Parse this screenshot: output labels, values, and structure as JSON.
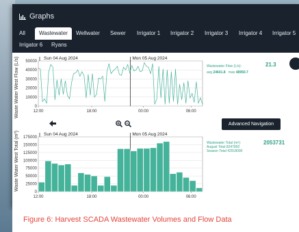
{
  "header": {
    "title": "Graphs",
    "title_icon": "bar-chart-icon"
  },
  "tabs": [
    {
      "label": "All",
      "active": false
    },
    {
      "label": "Wastewater",
      "active": true
    },
    {
      "label": "Wellwater",
      "active": false
    },
    {
      "label": "Sewer",
      "active": false
    },
    {
      "label": "Irrigator 1",
      "active": false
    },
    {
      "label": "Irrigator 2",
      "active": false
    },
    {
      "label": "Irrigator 3",
      "active": false
    },
    {
      "label": "Irrigator 4",
      "active": false
    },
    {
      "label": "Irrigator 5",
      "active": false
    },
    {
      "label": "Irrigator 6",
      "active": false
    },
    {
      "label": "Ryans",
      "active": false
    }
  ],
  "flow_readout": {
    "label": "Wastewater Flow (L/s):",
    "avg_text": "avg",
    "avg_value": "24641.8",
    "max_text": "max",
    "max_value": "48950.7",
    "current": "21.3"
  },
  "total_readout": {
    "label": "Wastewater Total (m³):",
    "august": "August Total 8247892",
    "season": "Season Total 42918090",
    "current": "2053731"
  },
  "nav": {
    "advanced_label": "Advanced Navigation",
    "back_icon": "arrow-left-icon",
    "zoom_in_icon": "zoom-in-icon",
    "zoom_out_icon": "zoom-out-icon"
  },
  "caption": "Figure 6: Harvest SCADA Wastewater Volumes and Flow Data",
  "colors": {
    "header_bg": "#1a222d",
    "series": "#45b29a",
    "caption": "#e2453a",
    "readout": "#2f9f84"
  },
  "chart_data": [
    {
      "type": "line",
      "ylabel": "Waste Water West Flow (L/s)",
      "ylim": [
        0,
        50000
      ],
      "yticks": [
        "0",
        "10000",
        "20000",
        "30000",
        "40000",
        "50000"
      ],
      "xticks": [
        "12:00",
        "18:00",
        "00:00",
        "06:00"
      ],
      "date_labels": [
        "Sun 04 Aug 2024",
        "Mon 05 Aug 2024"
      ],
      "x": [
        0,
        1,
        2,
        3,
        4,
        5,
        6,
        7,
        8,
        9,
        10,
        11,
        12,
        13,
        14,
        15,
        16,
        17,
        18,
        19,
        20,
        21,
        22,
        23,
        24,
        25,
        26,
        27,
        28,
        29,
        30,
        31,
        32,
        33,
        34,
        35,
        36,
        37,
        38,
        39,
        40,
        41,
        42,
        43,
        44,
        45,
        46,
        47,
        48,
        49,
        50,
        51,
        52,
        53,
        54,
        55,
        56,
        57,
        58,
        59,
        60,
        61,
        62,
        63,
        64,
        65,
        66,
        67,
        68,
        69,
        70,
        71,
        72,
        73,
        74,
        75,
        76,
        77,
        78,
        79
      ],
      "series": [
        {
          "values": [
            42000,
            41000,
            5000,
            8000,
            3000,
            38000,
            46000,
            43000,
            7000,
            29000,
            12000,
            30000,
            13000,
            28000,
            12000,
            8000,
            26000,
            36000,
            37000,
            40000,
            33000,
            38000,
            34000,
            9000,
            35000,
            12000,
            36000,
            10000,
            13000,
            31000,
            30000,
            33000,
            5000,
            38000,
            47000,
            36000,
            39000,
            41000,
            44000,
            35000,
            34000,
            43000,
            40000,
            46000,
            37000,
            45000,
            39000,
            40000,
            44000,
            38000,
            39000,
            48000,
            44000,
            43000,
            36000,
            47000,
            2000,
            8000,
            44000,
            9000,
            41000,
            2000,
            40000,
            3000,
            38000,
            5000,
            41000,
            2000,
            24000,
            7000,
            26000,
            3000,
            28000,
            9000,
            14000,
            4000,
            27000,
            3000,
            9000,
            2000
          ]
        }
      ]
    },
    {
      "type": "bar",
      "ylabel": "Waste Water West Total (m³)",
      "ylim": [
        0,
        175000
      ],
      "yticks": [
        "0",
        "25000",
        "50000",
        "75000",
        "100000",
        "125000",
        "150000",
        "175000"
      ],
      "xticks": [
        "12:00",
        "18:00",
        "00:00",
        "06:00"
      ],
      "date_labels": [
        "Sun 04 Aug 2024",
        "Mon 05 Aug 2024"
      ],
      "values": [
        30000,
        98000,
        90000,
        85000,
        88000,
        20000,
        60000,
        55000,
        50000,
        20000,
        48000,
        20000,
        137000,
        137000,
        130000,
        138000,
        138000,
        140000,
        155000,
        160000,
        57000,
        62000,
        45000,
        35000,
        12000
      ]
    }
  ]
}
